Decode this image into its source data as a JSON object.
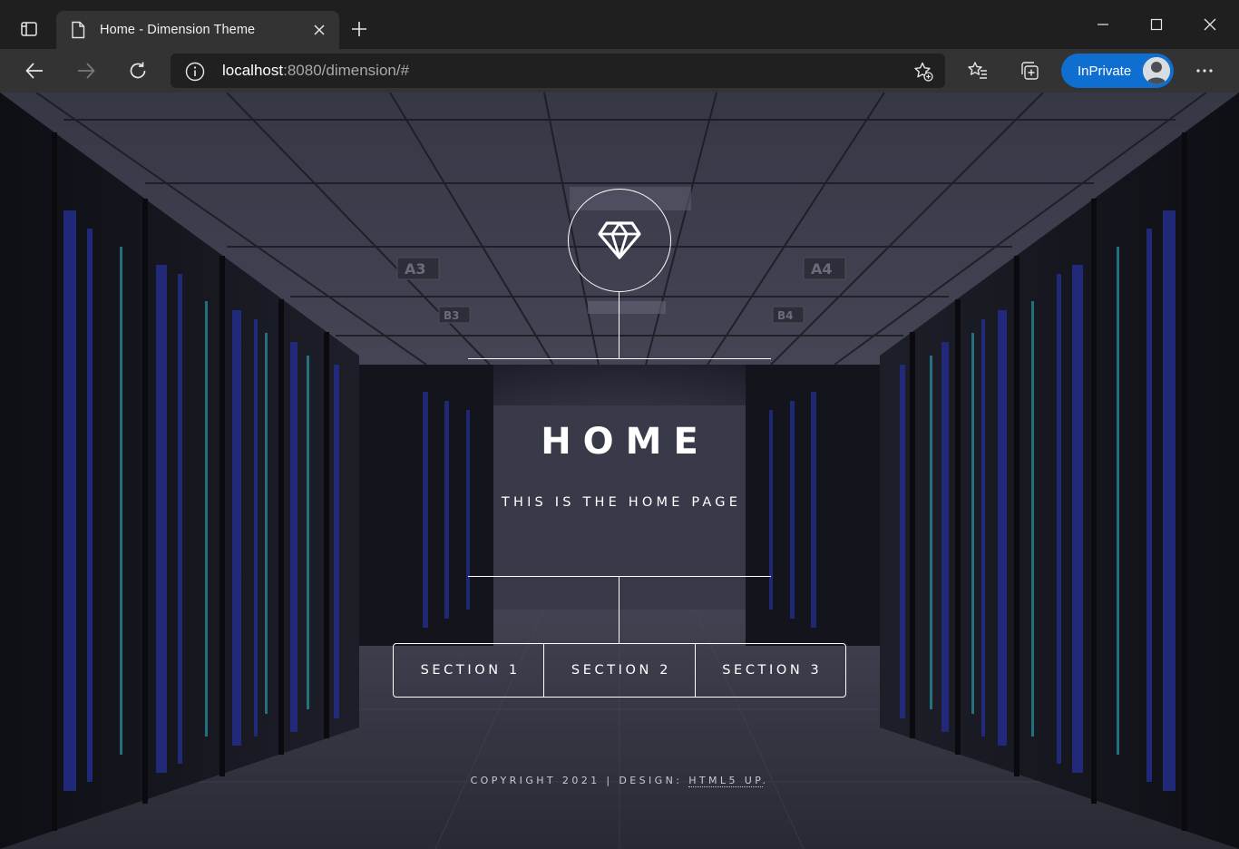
{
  "browser": {
    "tab": {
      "title": "Home - Dimension Theme"
    },
    "address": {
      "host": "localhost",
      "rest": ":8080/dimension/#"
    },
    "profile": {
      "label": "InPrivate"
    },
    "icons": {
      "tab_actions": "tab-actions-icon",
      "page": "page-icon",
      "close_tab": "close-icon",
      "new_tab": "plus-icon",
      "minimize": "minimize-icon",
      "maximize": "maximize-icon",
      "close_window": "close-icon",
      "back": "back-arrow-icon",
      "forward": "forward-arrow-icon",
      "refresh": "refresh-icon",
      "site_info": "info-icon",
      "add_favorite": "star-plus-icon",
      "favorites": "favorites-icon",
      "collections": "collections-icon",
      "menu": "more-icon"
    }
  },
  "page": {
    "title": "HOME",
    "subtitle": "THIS IS THE HOME PAGE",
    "logo_icon": "diamond-icon",
    "nav": [
      {
        "label": "SECTION 1"
      },
      {
        "label": "SECTION 2"
      },
      {
        "label": "SECTION 3"
      }
    ],
    "footer": {
      "copyright": "COPYRIGHT 2021 | DESIGN: ",
      "link": "HTML5 UP",
      "end": "."
    },
    "background": {
      "signs": [
        "A3",
        "A4",
        "B3",
        "B4"
      ]
    }
  },
  "colors": {
    "accent_blue": "#0f6fd0",
    "chrome_dark": "#1f1f1f",
    "chrome_toolbar": "#333333"
  }
}
